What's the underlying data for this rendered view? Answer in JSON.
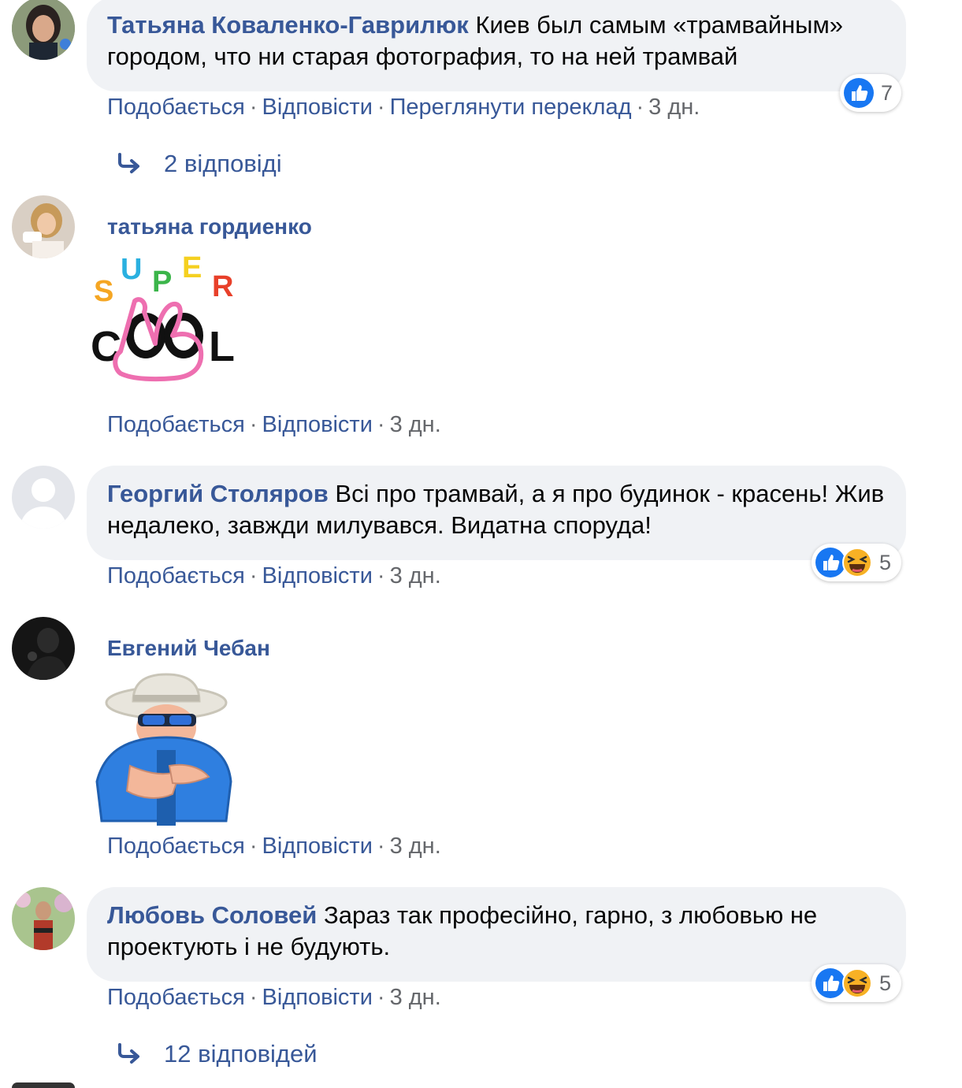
{
  "comments": [
    {
      "author": "Татьяна Коваленко-Гаврилюк",
      "text": "Киев был самым «трамвайным» городом, что ни старая фотография, то на ней трамвай",
      "like": "Подобається",
      "reply": "Відповісти",
      "translate": "Переглянути переклад",
      "time": "3 дн.",
      "reactions": {
        "types": [
          "like"
        ],
        "count": "7"
      },
      "replies_label": "2 відповіді"
    },
    {
      "author": "татьяна гордиенко",
      "sticker": {
        "name": "super-cool",
        "letters": [
          "S",
          "U",
          "P",
          "E",
          "R",
          "C",
          "L"
        ]
      },
      "like": "Подобається",
      "reply": "Відповісти",
      "time": "3 дн."
    },
    {
      "author": "Георгий Столяров",
      "text": "Всі про трамвай, а я про будинок - красень! Жив недалеко, завжди милувався. Видатна споруда!",
      "like": "Подобається",
      "reply": "Відповісти",
      "time": "3 дн.",
      "reactions": {
        "types": [
          "like",
          "haha"
        ],
        "count": "5"
      }
    },
    {
      "author": "Евгений Чебан",
      "sticker": {
        "name": "cool-grandpa-clapping"
      },
      "like": "Подобається",
      "reply": "Відповісти",
      "time": "3 дн."
    },
    {
      "author": "Любовь Соловей",
      "text": "Зараз так професійно, гарно, з любовью не проектують і не будують.",
      "like": "Подобається",
      "reply": "Відповісти",
      "time": "3 дн.",
      "reactions": {
        "types": [
          "like",
          "haha"
        ],
        "count": "5"
      },
      "replies_label": "12 відповідей"
    }
  ],
  "colors": {
    "link": "#385898",
    "meta": "#65676b",
    "bubble": "#f0f2f5",
    "like_blue": "#1877f2",
    "haha_yellow": "#f7b125"
  },
  "icons": [
    "like-icon",
    "haha-icon",
    "reply-arrow-icon"
  ]
}
